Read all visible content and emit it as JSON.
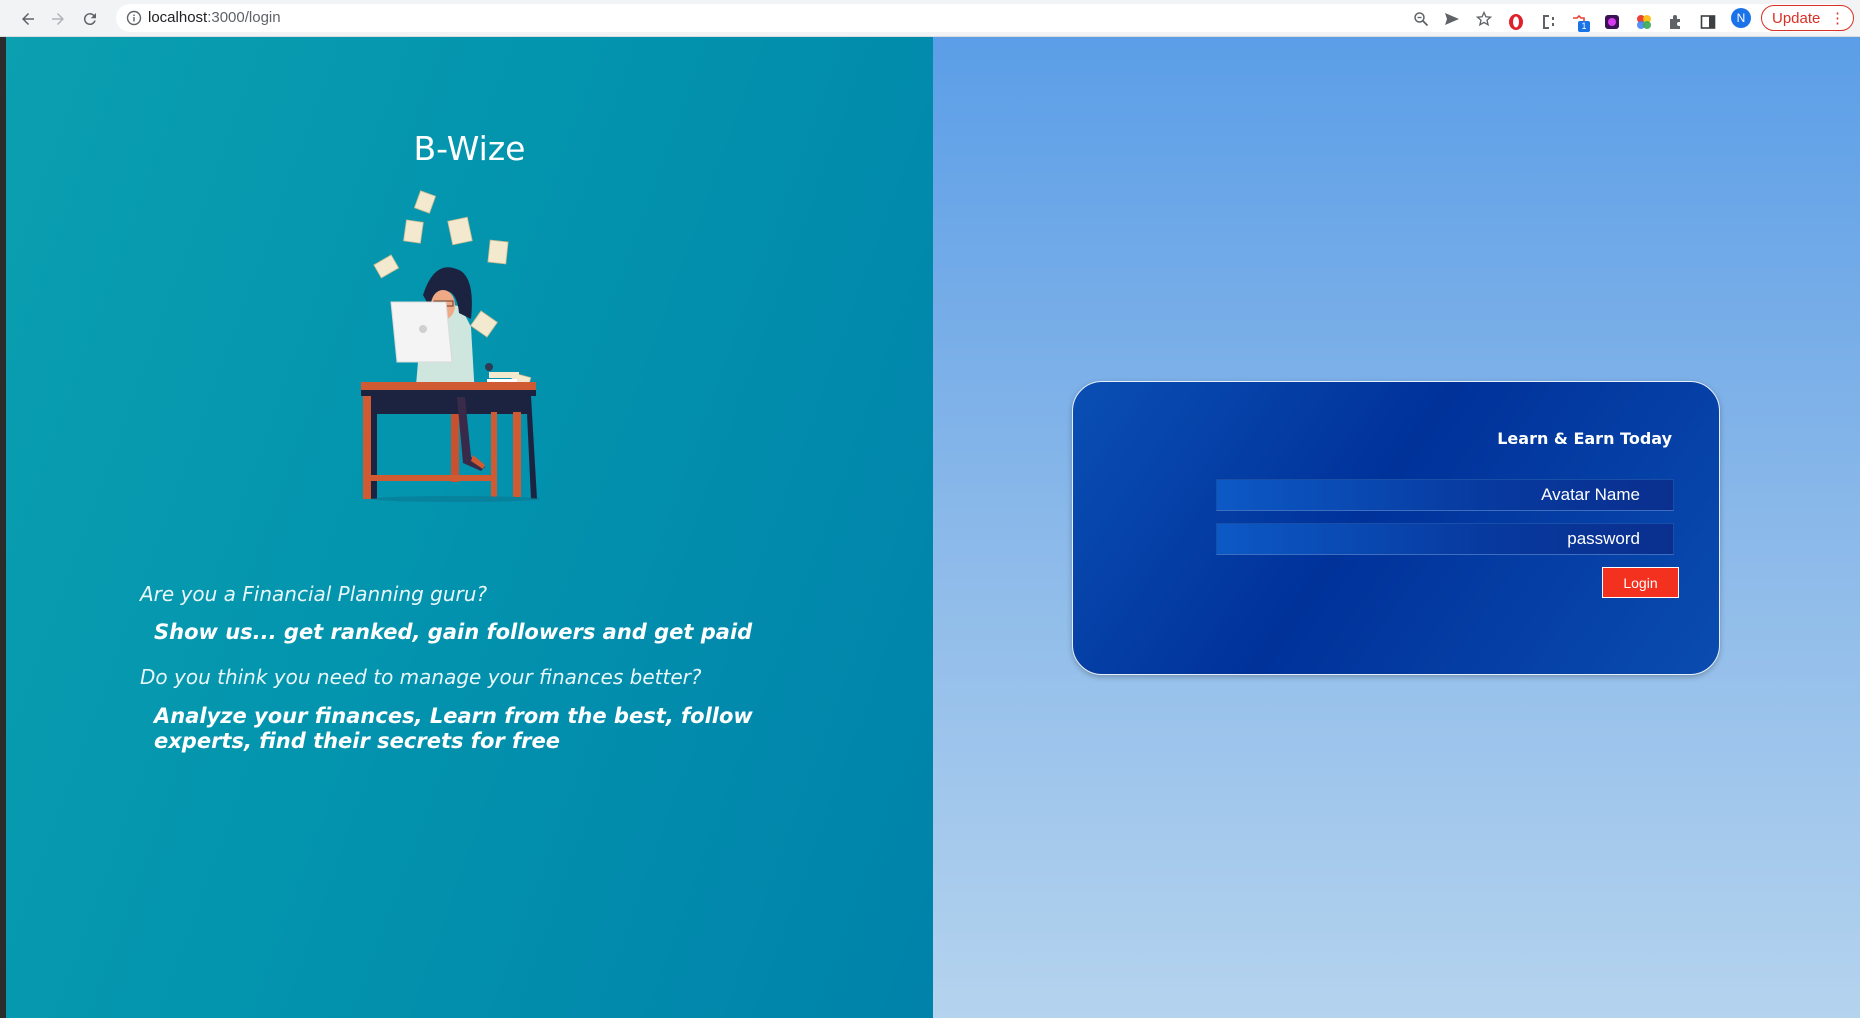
{
  "browser": {
    "url_host": "localhost",
    "url_rest": ":3000/login",
    "update_label": "Update",
    "profile_initial": "N",
    "extension_badge": "1",
    "icons": {
      "back": "back-arrow-icon",
      "forward": "forward-arrow-icon",
      "reload": "reload-icon",
      "site_info": "info-icon",
      "zoom": "zoom-icon",
      "send": "send-icon",
      "bookmark": "star-icon",
      "menu": "kebab-menu-icon"
    }
  },
  "hero": {
    "brand": "B-Wize",
    "question_1": "Are you a Financial Planning guru?",
    "answer_1": "Show us... get ranked, gain followers and get paid",
    "question_2": "Do you think you need to manage your finances better?",
    "answer_2": "Analyze your finances, Learn from the best, follow experts, find their secrets for free"
  },
  "login": {
    "title": "Learn & Earn Today",
    "username_placeholder": "Avatar Name",
    "password_placeholder": "password",
    "submit_label": "Login"
  },
  "colors": {
    "left_panel": "#0394ae",
    "right_panel_top": "#5b9ee7",
    "card": "#00329a",
    "login_button": "#f4311f",
    "update_accent": "#d93025"
  }
}
